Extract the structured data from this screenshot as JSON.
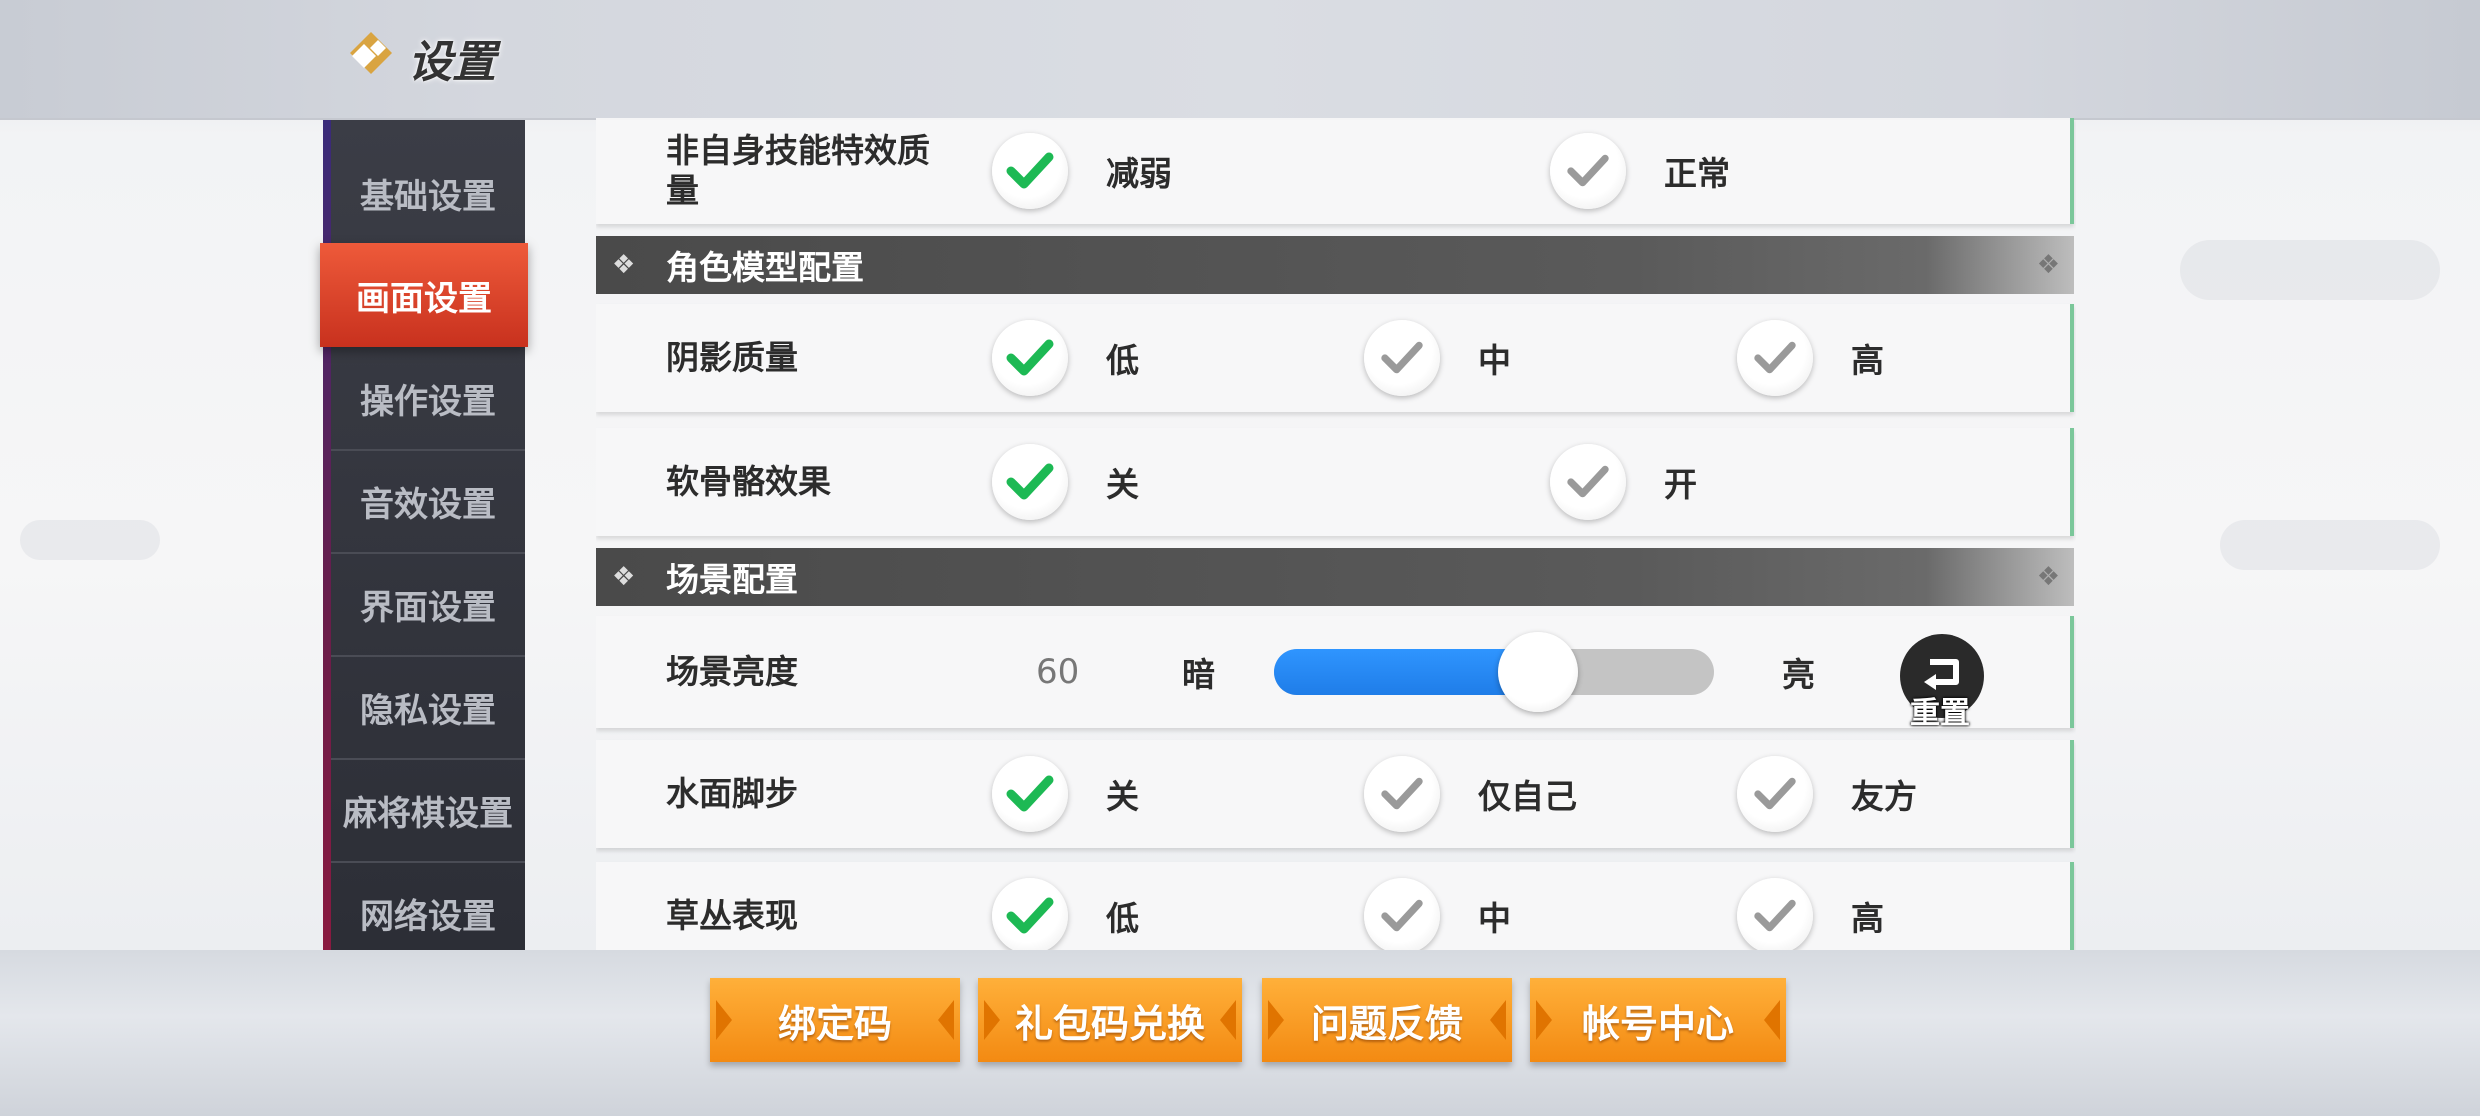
{
  "header": {
    "title": "设置"
  },
  "sidebar": {
    "items": [
      {
        "label": "基础设置",
        "active": false
      },
      {
        "label": "画面设置",
        "active": true
      },
      {
        "label": "操作设置",
        "active": false
      },
      {
        "label": "音效设置",
        "active": false
      },
      {
        "label": "界面设置",
        "active": false
      },
      {
        "label": "隐私设置",
        "active": false
      },
      {
        "label": "麻将棋设置",
        "active": false
      },
      {
        "label": "网络设置",
        "active": false
      }
    ]
  },
  "settings": {
    "skill_effect": {
      "label": "非自身技能特效质量",
      "label_line1": "非自身技能特效质",
      "label_line2": "量",
      "options": [
        "减弱",
        "正常"
      ],
      "selected": 0
    },
    "section_model": "角色模型配置",
    "shadow": {
      "label": "阴影质量",
      "options": [
        "低",
        "中",
        "高"
      ],
      "selected": 0
    },
    "soft_bone": {
      "label": "软骨骼效果",
      "options": [
        "关",
        "开"
      ],
      "selected": 0
    },
    "section_scene": "场景配置",
    "brightness": {
      "label": "场景亮度",
      "value": "60",
      "dark_label": "暗",
      "light_label": "亮",
      "fraction": 0.6,
      "reset_label": "重置"
    },
    "water_step": {
      "label": "水面脚步",
      "options": [
        "关",
        "仅自己",
        "友方"
      ],
      "selected": 0
    },
    "grass": {
      "label": "草丛表现",
      "options": [
        "低",
        "中",
        "高"
      ],
      "selected": 0
    }
  },
  "footer": {
    "buttons": [
      "绑定码",
      "礼包码兑换",
      "问题反馈",
      "帐号中心"
    ]
  },
  "colors": {
    "check_selected": "#1db954",
    "check_unselected": "#9a9a9a",
    "active_tab": "#e24a2e",
    "button": "#f7991f",
    "slider_fill": "#2f95ff"
  }
}
